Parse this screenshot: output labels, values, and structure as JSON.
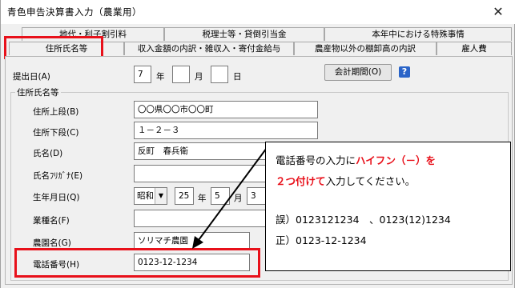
{
  "window": {
    "title": "青色申告決算書入力（農業用）",
    "close_symbol": "✕"
  },
  "tabs_back": [
    "地代・利子割引料",
    "税理士等・貸倒引当金",
    "本年中における特殊事情"
  ],
  "tabs_front": [
    "住所氏名等",
    "収入金額の内訳・雑収入・寄付金給与",
    "農産物以外の棚卸高の内訳",
    "雇人費"
  ],
  "submit_date": {
    "label": "提出日(A)",
    "year_value": "7",
    "year_unit": "年",
    "month_value": "",
    "month_unit": "月",
    "day_value": "",
    "day_unit": "日"
  },
  "fiscal_period_button": "会計期間(O)",
  "help_icon": "?",
  "group": {
    "title": "住所氏名等",
    "address_upper": {
      "label": "住所上段(B)",
      "value": "〇〇県〇〇市〇〇町"
    },
    "address_lower": {
      "label": "住所下段(C)",
      "value": "１－２－３"
    },
    "name": {
      "label": "氏名(D)",
      "value": "反町　春兵衛"
    },
    "name_kana": {
      "label": "氏名ﾌﾘｶﾞﾅ(E)",
      "value": ""
    },
    "birthdate": {
      "label": "生年月日(Q)",
      "era": "昭和",
      "era_arrow": "▼",
      "year": "25",
      "year_unit": "年",
      "month": "5",
      "month_unit": "月",
      "day": "3"
    },
    "business_type": {
      "label": "業種名(F)",
      "value": ""
    },
    "farm_name": {
      "label": "農園名(G)",
      "value": "ソリマチ農園"
    },
    "phone": {
      "label": "電話番号(H)",
      "value": "0123-12-1234"
    }
  },
  "callout": {
    "line1_prefix": "電話番号の入力に",
    "line1_red": "ハイフン（－）を",
    "line2_red": "２つ付けて",
    "line2_suffix": "入力してください。",
    "wrong": "誤）0123121234　、0123(12)1234",
    "correct": "正）0123-12-1234"
  },
  "colors": {
    "highlight": "#e8101a",
    "window_bg": "#f0f0f0"
  }
}
